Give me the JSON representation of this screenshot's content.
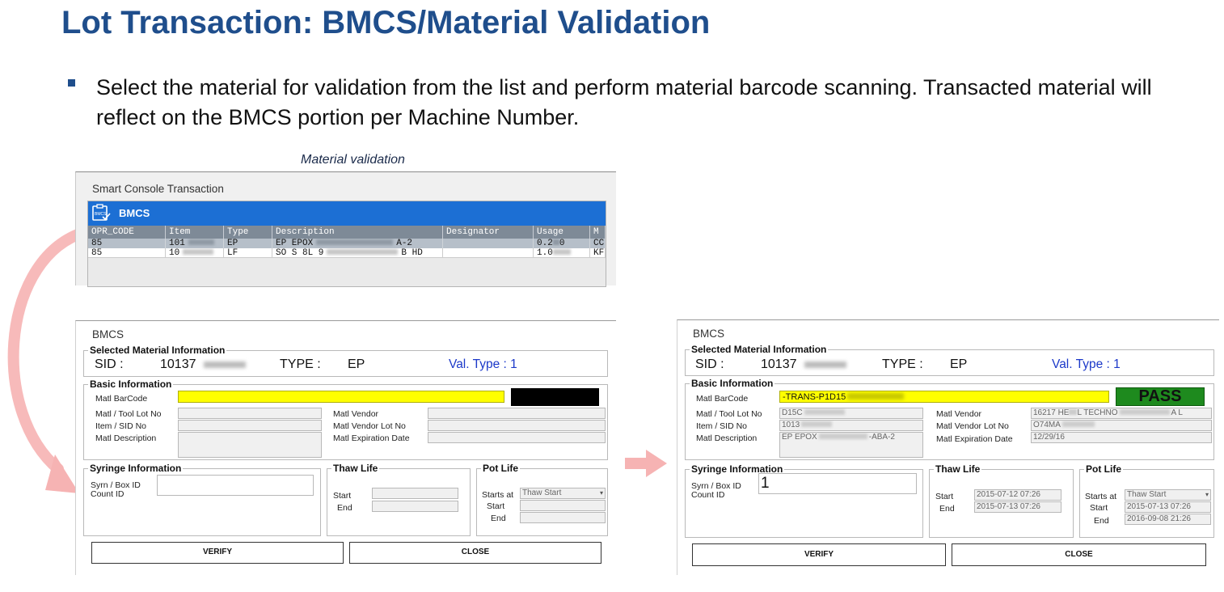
{
  "title": "Lot Transaction: BMCS/Material Validation",
  "bullet": "Select the material for validation from the list and perform material barcode scanning. Transacted material will reflect on the BMCS portion per Machine Number.",
  "caption": "Material validation",
  "console": {
    "window_title": "Smart Console Transaction",
    "header_label": "BMCS",
    "icon_label": "BMCS",
    "columns": [
      "OPR_CODE",
      "Item",
      "Type",
      "Description",
      "Designator",
      "Usage",
      "M"
    ],
    "rows": [
      [
        "85",
        "101",
        "EP",
        "EP EPOX",
        "A-2",
        "",
        "0.2",
        "0",
        "CC"
      ],
      [
        "85",
        "10",
        "LF",
        "SO S 8L 9",
        "B HD",
        "",
        "1.0",
        "",
        "KF"
      ]
    ]
  },
  "dialog_left": {
    "title": "BMCS",
    "selected_group": "Selected Material Information",
    "sid_label": "SID :",
    "sid_value": "10137",
    "type_label": "TYPE :",
    "type_value": "EP",
    "val_type": "Val. Type : 1",
    "basic_group": "Basic Information",
    "barcode_label": "Matl BarCode",
    "tool_lot_label": "Matl / Tool Lot No",
    "item_sid_label": "Item / SID No",
    "desc_label": "Matl Description",
    "vendor_label": "Matl Vendor",
    "vendor_lot_label": "Matl Vendor Lot No",
    "expiry_label": "Matl Expiration Date",
    "syringe_group": "Syringe Information",
    "syrn_label1": "Syrn / Box ID",
    "syrn_label2": "Count ID",
    "thaw_group": "Thaw Life",
    "pot_group": "Pot Life",
    "start_label": "Start",
    "end_label": "End",
    "starts_at_label": "Starts at",
    "starts_at_value": "Thaw Start",
    "verify": "VERIFY",
    "close": "CLOSE"
  },
  "dialog_right": {
    "title": "BMCS",
    "selected_group": "Selected Material Information",
    "sid_label": "SID :",
    "sid_value": "10137",
    "type_label": "TYPE :",
    "type_value": "EP",
    "val_type": "Val. Type : 1",
    "basic_group": "Basic Information",
    "barcode_label": "Matl BarCode",
    "barcode_value": "-TRANS-P1D15",
    "pass": "PASS",
    "tool_lot_label": "Matl / Tool Lot No",
    "tool_lot_value": "D15C",
    "item_sid_label": "Item / SID No",
    "item_sid_value": "1013",
    "desc_label": "Matl Description",
    "desc_value": "EP EPOX",
    "desc_value2": "-ABA-2",
    "vendor_label": "Matl Vendor",
    "vendor_value": "16217 HE",
    "vendor_value2": "L TECHNO",
    "vendor_value3": "A L",
    "vendor_lot_label": "Matl Vendor Lot No",
    "vendor_lot_value": "O74MA",
    "expiry_label": "Matl Expiration Date",
    "expiry_value": "12/29/16",
    "syringe_group": "Syringe Information",
    "syrn_label1": "Syrn / Box ID",
    "syrn_label2": "Count ID",
    "syrn_value": "1",
    "thaw_group": "Thaw Life",
    "pot_group": "Pot Life",
    "start_label": "Start",
    "end_label": "End",
    "thaw_start": "2015-07-12 07:26",
    "thaw_end": "2015-07-13 07:26",
    "starts_at_label": "Starts at",
    "starts_at_value": "Thaw Start",
    "pot_start": "2015-07-13 07:26",
    "pot_end": "2016-09-08 21:26",
    "verify": "VERIFY",
    "close": "CLOSE"
  },
  "colors": {
    "title": "#1f4e8c",
    "grid_header": "#1c6fd4",
    "barcode_field": "#ffff00",
    "pass_bg": "#1e8a1e",
    "val_type": "#1c39c9",
    "arrow": "#f6b3b3"
  }
}
